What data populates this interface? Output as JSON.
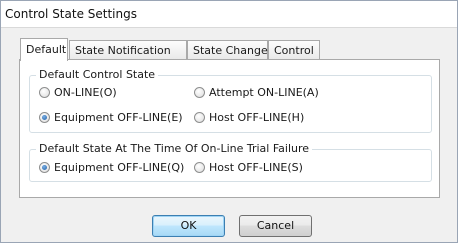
{
  "window": {
    "title": "Control State Settings"
  },
  "tabs": [
    {
      "label": "Default",
      "active": true
    },
    {
      "label": "State Notification",
      "active": false
    },
    {
      "label": "State Change",
      "active": false
    },
    {
      "label": "Control",
      "active": false
    }
  ],
  "default_control_state": {
    "legend": "Default Control State",
    "options": [
      {
        "label": "ON-LINE(O)",
        "checked": false
      },
      {
        "label": "Attempt ON-LINE(A)",
        "checked": false
      },
      {
        "label": "Equipment OFF-LINE(E)",
        "checked": true
      },
      {
        "label": "Host OFF-LINE(H)",
        "checked": false
      }
    ]
  },
  "online_trial_failure": {
    "legend": "Default State At The Time Of On-Line Trial Failure",
    "options": [
      {
        "label": "Equipment OFF-LINE(Q)",
        "checked": true
      },
      {
        "label": "Host OFF-LINE(S)",
        "checked": false
      }
    ]
  },
  "buttons": {
    "ok": "OK",
    "cancel": "Cancel"
  }
}
